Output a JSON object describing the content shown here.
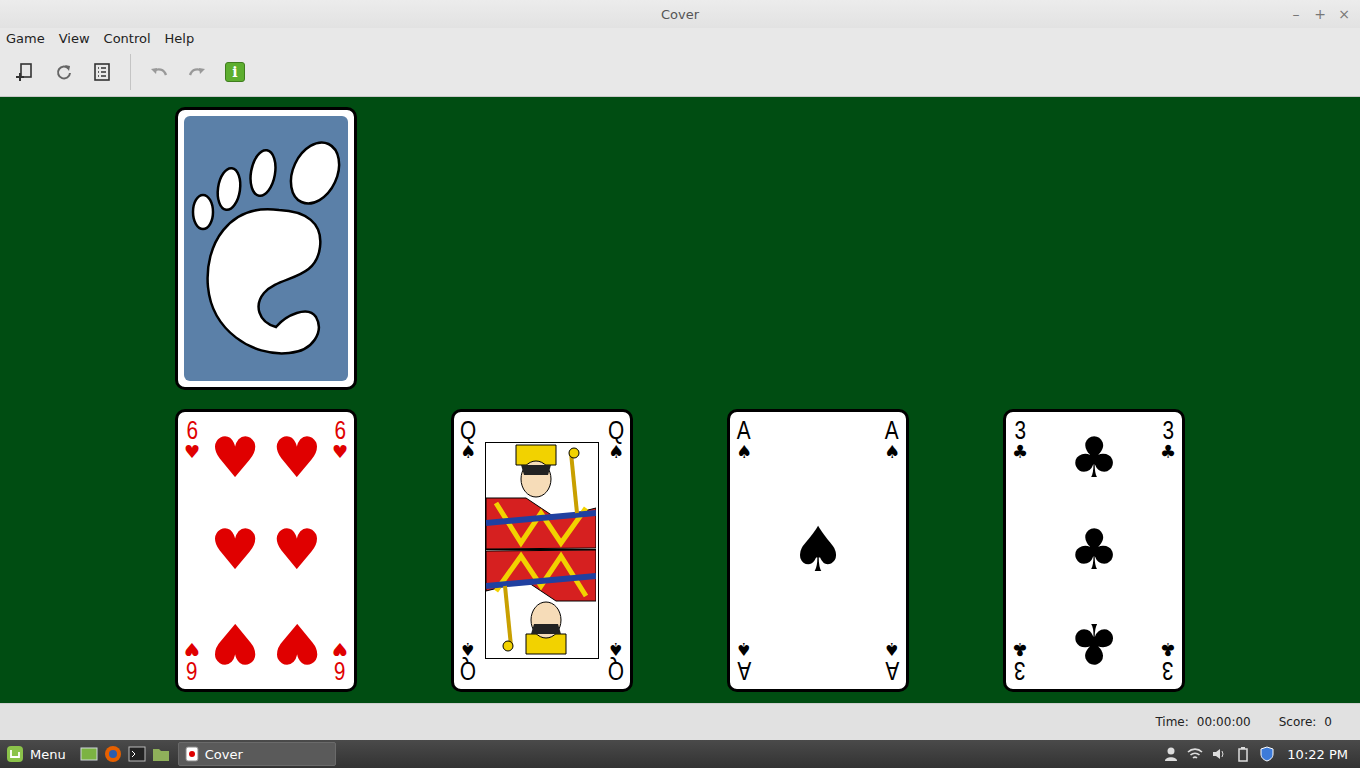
{
  "window": {
    "title": "Cover",
    "controls": [
      "–",
      "+",
      "×"
    ]
  },
  "menu": [
    "Game",
    "View",
    "Control",
    "Help"
  ],
  "toolbar": [
    [
      {
        "kind": "new-game",
        "disabled": false
      },
      {
        "kind": "restart",
        "disabled": false
      },
      {
        "kind": "statistics",
        "disabled": false
      }
    ],
    [
      {
        "kind": "undo",
        "disabled": true
      },
      {
        "kind": "redo",
        "disabled": true
      },
      {
        "kind": "hint",
        "disabled": false,
        "glyph": "i"
      }
    ]
  ],
  "stock": {
    "face_down": true
  },
  "tableau": [
    {
      "rank": "6",
      "suit": "♥",
      "color": "#e00000",
      "kind": "pips",
      "pips": 6
    },
    {
      "rank": "Q",
      "suit": "♠",
      "color": "#000000",
      "kind": "face"
    },
    {
      "rank": "A",
      "suit": "♠",
      "color": "#000000",
      "kind": "pips",
      "pips": 1
    },
    {
      "rank": "3",
      "suit": "♣",
      "color": "#000000",
      "kind": "pips",
      "pips": 3
    }
  ],
  "status_bar": {
    "time_label": "Time:",
    "time": "00:00:00",
    "score_label": "Score:",
    "score": "0"
  },
  "taskbar": {
    "menu": "Menu",
    "windows": [
      {
        "title": "Cover",
        "selected": true
      }
    ],
    "clock": "10:22 PM"
  }
}
